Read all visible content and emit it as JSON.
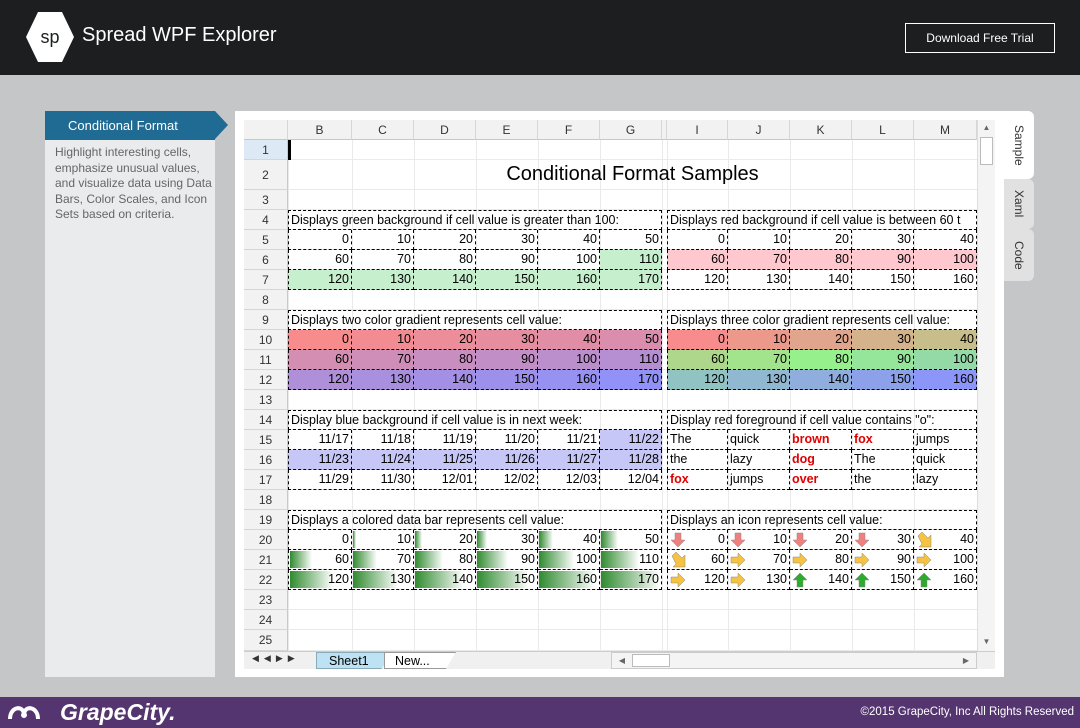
{
  "header": {
    "logo_text": "sp",
    "title": "Spread WPF Explorer",
    "trial_button": "Download Free Trial"
  },
  "sidebar": {
    "selected": "Conditional Format",
    "description": "Highlight interesting cells, emphasize unusual values, and visualize data using Data Bars, Color Scales, and Icon Sets based on criteria."
  },
  "tabs": [
    "Sample",
    "Xaml",
    "Code"
  ],
  "sheet": {
    "columns": [
      "B",
      "C",
      "D",
      "E",
      "F",
      "G",
      "I",
      "J",
      "K",
      "L",
      "M"
    ],
    "rows": [
      "1",
      "2",
      "3",
      "4",
      "5",
      "6",
      "7",
      "8",
      "9",
      "10",
      "11",
      "12",
      "13",
      "14",
      "15",
      "16",
      "17",
      "18",
      "19",
      "20",
      "21",
      "22",
      "23",
      "24",
      "25"
    ],
    "title": "Conditional Format Samples",
    "captions": {
      "r4_left": "Displays green background if cell value is greater than 100:",
      "r4_right": "Displays red background if cell value is between 60 t",
      "r9_left": "Displays two color gradient represents cell value:",
      "r9_right": "Displays three color gradient represents cell value:",
      "r14_left": "Display blue background if cell value is in next week:",
      "r14_right": "Display red foreground if cell value contains \"o\":",
      "r19_left": "Displays a colored data bar represents cell value:",
      "r19_right": "Displays an icon represents cell value:"
    },
    "values": {
      "r5": [
        "0",
        "10",
        "20",
        "30",
        "40",
        "50",
        "0",
        "10",
        "20",
        "30",
        "40"
      ],
      "r6": [
        "60",
        "70",
        "80",
        "90",
        "100",
        "110",
        "60",
        "70",
        "80",
        "90",
        "100"
      ],
      "r7": [
        "120",
        "130",
        "140",
        "150",
        "160",
        "170",
        "120",
        "130",
        "140",
        "150",
        "160"
      ],
      "r10": [
        "0",
        "10",
        "20",
        "30",
        "40",
        "50",
        "0",
        "10",
        "20",
        "30",
        "40"
      ],
      "r11": [
        "60",
        "70",
        "80",
        "90",
        "100",
        "110",
        "60",
        "70",
        "80",
        "90",
        "100"
      ],
      "r12": [
        "120",
        "130",
        "140",
        "150",
        "160",
        "170",
        "120",
        "130",
        "140",
        "150",
        "160"
      ],
      "r15": [
        "11/17",
        "11/18",
        "11/19",
        "11/20",
        "11/21",
        "11/22",
        "The",
        "quick",
        "brown",
        "fox",
        "jumps"
      ],
      "r16": [
        "11/23",
        "11/24",
        "11/25",
        "11/26",
        "11/27",
        "11/28",
        "the",
        "lazy",
        "dog",
        "The",
        "quick"
      ],
      "r17": [
        "11/29",
        "11/30",
        "12/01",
        "12/02",
        "12/03",
        "12/04",
        "fox",
        "jumps",
        "over",
        "the",
        "lazy"
      ],
      "r20": [
        "0",
        "10",
        "20",
        "30",
        "40",
        "50",
        "0",
        "10",
        "20",
        "30",
        "40"
      ],
      "r21": [
        "60",
        "70",
        "80",
        "90",
        "100",
        "110",
        "60",
        "70",
        "80",
        "90",
        "100"
      ],
      "r22": [
        "120",
        "130",
        "140",
        "150",
        "160",
        "170",
        "120",
        "130",
        "140",
        "150",
        "160"
      ]
    },
    "icons": {
      "r20": [
        "arrow-down-red-icon",
        "arrow-down-red-icon",
        "arrow-down-red-icon",
        "arrow-down-red-icon",
        "arrow-downright-yellow-icon"
      ],
      "r21": [
        "arrow-downright-yellow-icon",
        "arrow-right-yellow-icon",
        "arrow-right-yellow-icon",
        "arrow-right-yellow-icon",
        "arrow-right-yellow-icon"
      ],
      "r22": [
        "arrow-upright-yellow-icon",
        "arrow-upright-yellow-icon",
        "arrow-up-green-icon",
        "arrow-up-green-icon",
        "arrow-up-green-icon"
      ]
    },
    "sheet_tabs": [
      "Sheet1",
      "New..."
    ]
  },
  "footer": {
    "brand": "GrapeCity.",
    "copyright": "©2015 GrapeCity, Inc All Rights Reserved"
  },
  "colors": {
    "header_bg": "#1c1e20",
    "accent": "#1f6b94",
    "footer_bg": "#54356f",
    "green_fill": "#c6efce",
    "red_fill": "#ffc7ce",
    "blue_fill": "#c7c7f7",
    "red_text": "#e00000",
    "databar": "#2f8a2f"
  }
}
